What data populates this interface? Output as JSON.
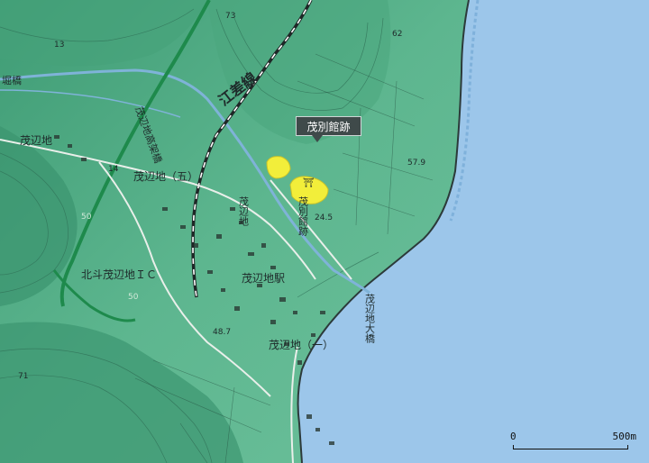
{
  "map": {
    "site_callout": "茂別館跡",
    "labels": {
      "esashi_line": "江差線",
      "bridge_top": "堀橋",
      "moheji": "茂辺地",
      "moheji_5": "茂辺地（五）",
      "moheji_1": "茂辺地（一）",
      "moheji_station": "茂辺地駅",
      "hokuto_ic": "北斗茂辺地ＩＣ",
      "moheji_kokaibashi": "茂辺地高架橋",
      "moheji_ohashi": "茂辺地大橋",
      "site_vertical": "茂別館跡",
      "moheji_vertical": "茂辺地"
    },
    "elevations": [
      "73",
      "13",
      "62",
      "57.9",
      "24.5",
      "50",
      "50",
      "48.7",
      "71",
      "14"
    ],
    "scale": {
      "start": "0",
      "end": "500m"
    }
  },
  "colors": {
    "sea": "#9cc6ea",
    "land": "#5cb48e",
    "highland": "#3e9a72",
    "highlight": "#f2ee3a"
  }
}
